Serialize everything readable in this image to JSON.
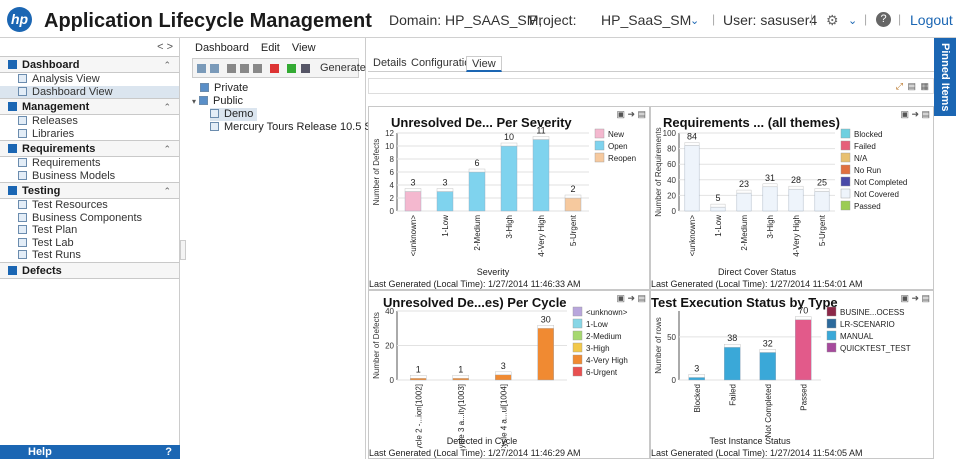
{
  "header": {
    "logo": "hp",
    "title": "Application Lifecycle Management",
    "domain": "Domain: HP_SAAS_SM,",
    "project_label": "Project:",
    "project": "HP_SaaS_SM",
    "user": "User: sasuser4",
    "logout": "Logout"
  },
  "sidebar": {
    "nav_arrows": "< >",
    "help": "Help",
    "help_icon": "?",
    "sections": [
      {
        "title": "Dashboard",
        "items": [
          "Analysis View",
          "Dashboard View"
        ]
      },
      {
        "title": "Management",
        "items": [
          "Releases",
          "Libraries"
        ]
      },
      {
        "title": "Requirements",
        "items": [
          "Requirements",
          "Business Models"
        ]
      },
      {
        "title": "Testing",
        "items": [
          "Test Resources",
          "Business Components",
          "Test Plan",
          "Test Lab",
          "Test Runs"
        ]
      },
      {
        "title": "Defects",
        "items": []
      }
    ]
  },
  "tree": {
    "menu": [
      "Dashboard",
      "Edit",
      "View"
    ],
    "generate": "Generate",
    "nodes": [
      "Private",
      "Public",
      "Demo",
      "Mercury Tours Release 10.5 Status"
    ]
  },
  "tabs": [
    "Details",
    "Configuration",
    "View"
  ],
  "pinned": "Pinned Items",
  "panes": [
    {
      "title": "Unresolved De... Per Severity",
      "footer": "Last Generated (Local Time): 1/27/2014 11:46:33 AM"
    },
    {
      "title": "Requirements ... (all themes)",
      "footer": "Last Generated (Local Time): 1/27/2014 11:54:01 AM"
    },
    {
      "title": "Unresolved De...es) Per Cycle",
      "footer": "Last Generated (Local Time): 1/27/2014 11:46:29 AM"
    },
    {
      "title": "Test Execution Status by Type",
      "footer": "Last Generated (Local Time): 1/27/2014 11:54:05 AM"
    }
  ],
  "chart_data": [
    {
      "type": "bar",
      "categories": [
        "<unknown>",
        "1-Low",
        "2-Medium",
        "3-High",
        "4-Very High",
        "5-Urgent"
      ],
      "values": [
        3,
        3,
        6,
        10,
        11,
        2
      ],
      "series": [
        {
          "name": "New",
          "color": "#f4b8cf"
        },
        {
          "name": "Open",
          "color": "#7fd3ee"
        },
        {
          "name": "Reopen",
          "color": "#f6c99e"
        }
      ],
      "bar_colors": [
        "#f4b8cf",
        "#7fd3ee",
        "#7fd3ee",
        "#7fd3ee",
        "#7fd3ee",
        "#f6c99e"
      ],
      "xlabel": "Severity",
      "ylabel": "Number of Defects",
      "yticks": [
        0,
        2,
        4,
        6,
        8,
        10,
        12
      ],
      "ylim": [
        0,
        12
      ]
    },
    {
      "type": "bar",
      "categories": [
        "<unknown>",
        "1-Low",
        "2-Medium",
        "3-High",
        "4-Very High",
        "5-Urgent"
      ],
      "values": [
        84,
        5,
        23,
        31,
        28,
        25
      ],
      "series": [
        {
          "name": "Blocked",
          "color": "#6fd0e0"
        },
        {
          "name": "Failed",
          "color": "#e6607a"
        },
        {
          "name": "N/A",
          "color": "#e8c070"
        },
        {
          "name": "No Run",
          "color": "#e07040"
        },
        {
          "name": "Not Completed",
          "color": "#4a4aa8"
        },
        {
          "name": "Not Covered",
          "color": "#eef4fb"
        },
        {
          "name": "Passed",
          "color": "#9ccc55"
        }
      ],
      "bar_colors": [
        "#eef4fb",
        "#eef4fb",
        "#eef4fb",
        "#eef4fb",
        "#eef4fb",
        "#eef4fb"
      ],
      "xlabel": "Direct Cover Status",
      "ylabel": "Number of Requirements",
      "yticks": [
        0,
        20,
        40,
        60,
        80,
        100
      ],
      "ylim": [
        0,
        100
      ]
    },
    {
      "type": "bar",
      "categories": [
        "Cycle 2 -...ion[1002]",
        "Cycle 3 a...ity[1003]",
        "Cycle 4 a...ul[1004]",
        ""
      ],
      "values": [
        1,
        1,
        3,
        30
      ],
      "series": [
        {
          "name": "<unknown>",
          "color": "#b8a6dc"
        },
        {
          "name": "1-Low",
          "color": "#88d6e6"
        },
        {
          "name": "2-Medium",
          "color": "#a6d870"
        },
        {
          "name": "3-High",
          "color": "#f2c84a"
        },
        {
          "name": "4-Very High",
          "color": "#f08a32"
        },
        {
          "name": "6-Urgent",
          "color": "#e85050"
        }
      ],
      "bar_colors": [
        "#f08a32",
        "#f08a32",
        "#f08a32",
        "#f08a32"
      ],
      "xlabel": "Detected in Cycle",
      "ylabel": "Number of Defects",
      "yticks": [
        0,
        20,
        40
      ],
      "ylim": [
        0,
        40
      ]
    },
    {
      "type": "bar",
      "categories": [
        "Blocked",
        "Failed",
        "Not Completed",
        "Passed"
      ],
      "values": [
        3,
        38,
        32,
        70
      ],
      "series": [
        {
          "name": "BUSINE...OCESS",
          "color": "#8c2848"
        },
        {
          "name": "LR-SCENARIO",
          "color": "#2c6a9c"
        },
        {
          "name": "MANUAL",
          "color": "#3aa8d8"
        },
        {
          "name": "QUICKTEST_TEST",
          "color": "#a64a9c"
        }
      ],
      "bar_colors": [
        "#3aa8d8",
        "#3aa8d8",
        "#3aa8d8",
        "#e25a8a"
      ],
      "xlabel": "Test Instance Status",
      "ylabel": "Number of rows",
      "yticks": [
        0,
        50
      ],
      "ylim": [
        0,
        80
      ]
    }
  ]
}
